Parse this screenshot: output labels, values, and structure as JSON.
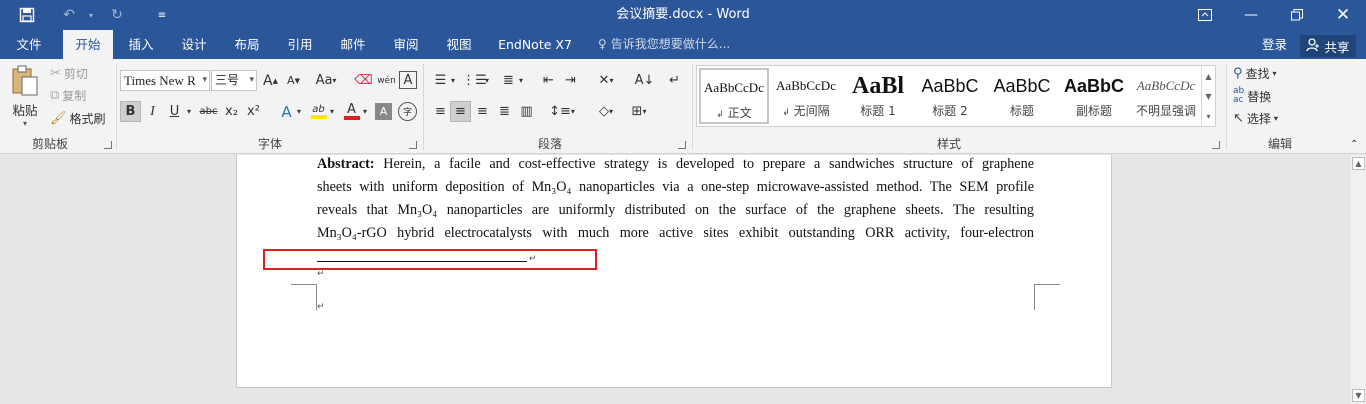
{
  "titlebar": {
    "title": "会议摘要.docx - Word",
    "save_icon": "save-icon",
    "undo_icon": "undo-icon",
    "redo_icon": "redo-icon",
    "customize_icon": "customize-icon"
  },
  "tabs": [
    {
      "label": "文件"
    },
    {
      "label": "开始"
    },
    {
      "label": "插入"
    },
    {
      "label": "设计"
    },
    {
      "label": "布局"
    },
    {
      "label": "引用"
    },
    {
      "label": "邮件"
    },
    {
      "label": "审阅"
    },
    {
      "label": "视图"
    },
    {
      "label": "EndNote X7"
    }
  ],
  "tellme": "告诉我您想要做什么...",
  "login": "登录",
  "share": "共享",
  "clipboard": {
    "paste": "粘贴",
    "cut": "剪切",
    "copy": "复制",
    "format_painter": "格式刷",
    "label": "剪贴板"
  },
  "font": {
    "name": "Times New R",
    "size": "三号",
    "label": "字体",
    "grow": "A",
    "shrink": "A",
    "change_case": "Aa",
    "phonetic": "wén",
    "border_char": "A",
    "bold": "B",
    "italic": "I",
    "underline": "U",
    "strike": "abc",
    "subscript": "x₂",
    "superscript": "x²",
    "effects": "A",
    "highlight": "ab",
    "font_color": "A",
    "shading": "A",
    "enclose": "字"
  },
  "paragraph": {
    "label": "段落"
  },
  "styles": {
    "label": "样式",
    "items": [
      {
        "sample": "AaBbCcDc",
        "name": "正文"
      },
      {
        "sample": "AaBbCcDc",
        "name": "无间隔"
      },
      {
        "sample": "AaBl",
        "name": "标题 1"
      },
      {
        "sample": "AaBbC",
        "name": "标题 2"
      },
      {
        "sample": "AaBbC",
        "name": "标题"
      },
      {
        "sample": "AaBbC",
        "name": "副标题"
      },
      {
        "sample": "AaBbCcDc",
        "name": "不明显强调"
      }
    ]
  },
  "editing": {
    "label": "编辑",
    "find": "查找",
    "replace": "替换",
    "select": "选择"
  },
  "document": {
    "abstract_label": "Abstract:",
    "lines": [
      " Herein, a facile and cost-effective strategy is developed to prepare a sandwiches structure of graphene",
      "sheets with uniform deposition of Mn₃O₄ nanoparticles via a one-step microwave-assisted method. The SEM profile",
      "reveals that Mn₃O₄ nanoparticles are uniformly distributed on the surface of the graphene sheets. The resulting",
      "Mn₃O₄-rGO hybrid electrocatalysts with much more active sites exhibit outstanding ORR activity, four-electron"
    ],
    "para_mark": "↵"
  },
  "colors": {
    "brand": "#2b579a",
    "highlight_box": "#e02020"
  }
}
